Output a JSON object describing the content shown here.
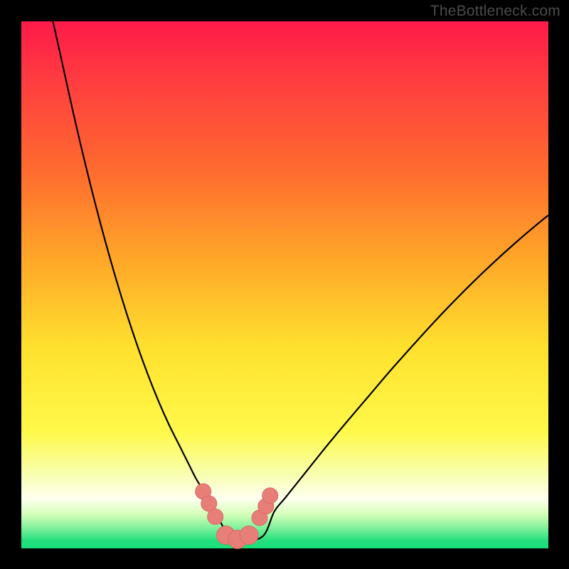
{
  "watermark": "TheBottleneck.com",
  "colors": {
    "black": "#000000",
    "marker_fill": "#e77f78",
    "marker_stroke": "#d86a63",
    "curve_stroke": "#000000",
    "gradient_stops": [
      {
        "offset": 0.0,
        "color": "#ff1a4a"
      },
      {
        "offset": 0.12,
        "color": "#ff3f3f"
      },
      {
        "offset": 0.28,
        "color": "#ff6a2f"
      },
      {
        "offset": 0.45,
        "color": "#ffa628"
      },
      {
        "offset": 0.62,
        "color": "#ffe12e"
      },
      {
        "offset": 0.78,
        "color": "#fff94a"
      },
      {
        "offset": 0.86,
        "color": "#f8ffb0"
      },
      {
        "offset": 0.905,
        "color": "#ffffef"
      },
      {
        "offset": 0.935,
        "color": "#d6ffba"
      },
      {
        "offset": 0.962,
        "color": "#7df09a"
      },
      {
        "offset": 0.985,
        "color": "#25e07e"
      },
      {
        "offset": 1.0,
        "color": "#17df7b"
      }
    ]
  },
  "chart_data": {
    "type": "line",
    "title": "",
    "xlabel": "",
    "ylabel": "",
    "xlim": [
      0,
      100
    ],
    "ylim": [
      0,
      100
    ],
    "note": "Bottleneck-style V-curve. x is normalized component balance (0–100), y is bottleneck percentage (0 = no bottleneck, 100 = full bottleneck). Minimum near x≈40.",
    "series": [
      {
        "name": "left-branch",
        "x": [
          6,
          8,
          10,
          12,
          14,
          16,
          18,
          20,
          22,
          24,
          26,
          28,
          30,
          32,
          33,
          34,
          35,
          36,
          37
        ],
        "values": [
          100,
          91,
          82,
          73.5,
          65.5,
          58,
          51,
          44.5,
          38.5,
          33,
          28,
          23.5,
          19.5,
          15.5,
          13.5,
          11.8,
          10,
          8.3,
          6.5
        ]
      },
      {
        "name": "floor",
        "x": [
          37,
          40,
          43,
          46
        ],
        "values": [
          2.5,
          1.5,
          1.5,
          2.5
        ]
      },
      {
        "name": "right-branch",
        "x": [
          46,
          48,
          50,
          54,
          58,
          62,
          66,
          70,
          74,
          78,
          82,
          86,
          90,
          94,
          98,
          100
        ],
        "values": [
          4.5,
          7,
          9.5,
          14.5,
          19.5,
          24.3,
          29,
          33.7,
          38.2,
          42.6,
          46.8,
          50.8,
          54.6,
          58.2,
          61.6,
          63.2
        ]
      }
    ],
    "markers": {
      "name": "highlighted-range",
      "x": [
        34.5,
        35.6,
        36.8,
        38.8,
        41.0,
        43.2,
        45.2,
        46.4,
        47.2
      ],
      "values": [
        10.8,
        8.5,
        6.0,
        2.5,
        1.7,
        2.5,
        5.8,
        8.0,
        10.0
      ],
      "radius": [
        11,
        11,
        11,
        13,
        13,
        13,
        11,
        11,
        11
      ]
    }
  }
}
